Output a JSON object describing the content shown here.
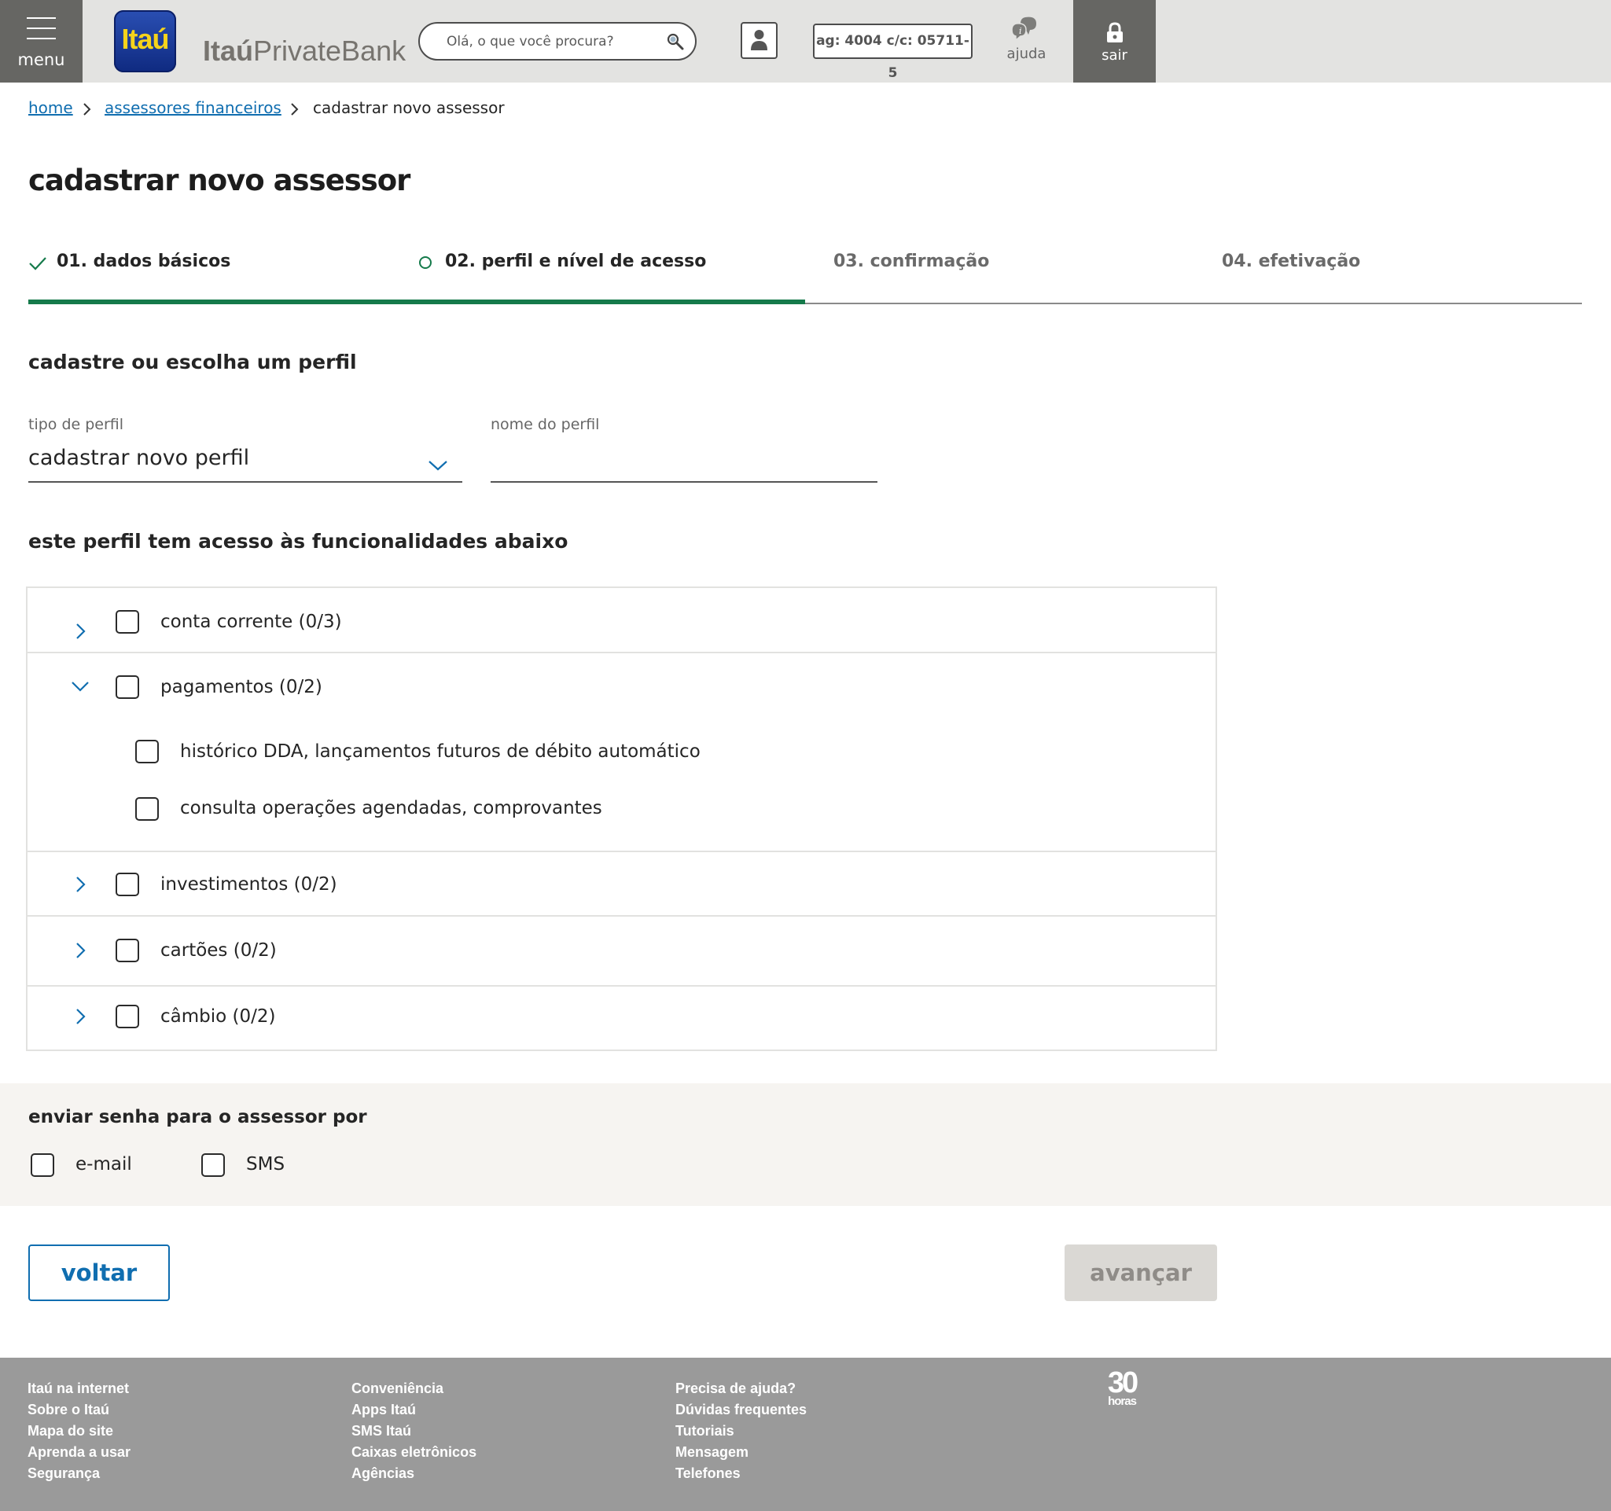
{
  "header": {
    "menu_label": "menu",
    "logo_text": "Itaú",
    "brand_bold": "Itaú",
    "brand_light": "PrivateBank",
    "search_placeholder": "Olá, o que você procura?",
    "account": "ag: 4004 c/c: 05711-5",
    "help_label": "ajuda",
    "logout_label": "sair"
  },
  "breadcrumb": {
    "home": "home",
    "advisors": "assessores financeiros",
    "current": "cadastrar novo assessor"
  },
  "page_title": "cadastrar novo assessor",
  "steps": [
    {
      "label": "01. dados básicos",
      "status": "done"
    },
    {
      "label": "02. perfil e nível de acesso",
      "status": "current"
    },
    {
      "label": "03. confirmação",
      "status": "todo"
    },
    {
      "label": "04. efetivação",
      "status": "todo"
    }
  ],
  "progress_fraction": 0.5,
  "profile": {
    "heading": "cadastre ou escolha um perfil",
    "type_label": "tipo de perfil",
    "type_value": "cadastrar novo perfil",
    "name_label": "nome do perfil",
    "name_value": ""
  },
  "features": {
    "heading": "este perfil tem acesso às funcionalidades abaixo",
    "groups": [
      {
        "label": "conta corrente (0/3)",
        "expanded": false,
        "checked": false
      },
      {
        "label": "pagamentos (0/2)",
        "expanded": true,
        "checked": false,
        "children": [
          {
            "label": "histórico DDA, lançamentos futuros de débito automático",
            "checked": false
          },
          {
            "label": "consulta operações agendadas, comprovantes",
            "checked": false
          }
        ]
      },
      {
        "label": "investimentos (0/2)",
        "expanded": false,
        "checked": false
      },
      {
        "label": "cartões (0/2)",
        "expanded": false,
        "checked": false
      },
      {
        "label": "câmbio (0/2)",
        "expanded": false,
        "checked": false
      }
    ]
  },
  "password": {
    "heading": "enviar senha para o assessor por",
    "options": [
      {
        "label": "e-mail",
        "checked": false
      },
      {
        "label": "SMS",
        "checked": false
      }
    ]
  },
  "actions": {
    "back": "voltar",
    "next": "avançar"
  },
  "footer": {
    "col1": [
      "Itaú na internet",
      "Sobre o Itaú",
      "Mapa do site",
      "Aprenda a usar",
      "Segurança"
    ],
    "col2": [
      "Conveniência",
      "Apps Itaú",
      "SMS Itaú",
      "Caixas eletrônicos",
      "Agências"
    ],
    "col3": [
      "Precisa de ajuda?",
      "Dúvidas frequentes",
      "Tutoriais",
      "Mensagem",
      "Telefones"
    ],
    "badge_number": "30",
    "badge_text": "horas"
  },
  "colors": {
    "accent_green": "#157a4b",
    "link_blue": "#106eb0",
    "header_gray": "#e3e3e1",
    "dark_gray": "#666663",
    "footer_gray": "#9a9a9a"
  }
}
